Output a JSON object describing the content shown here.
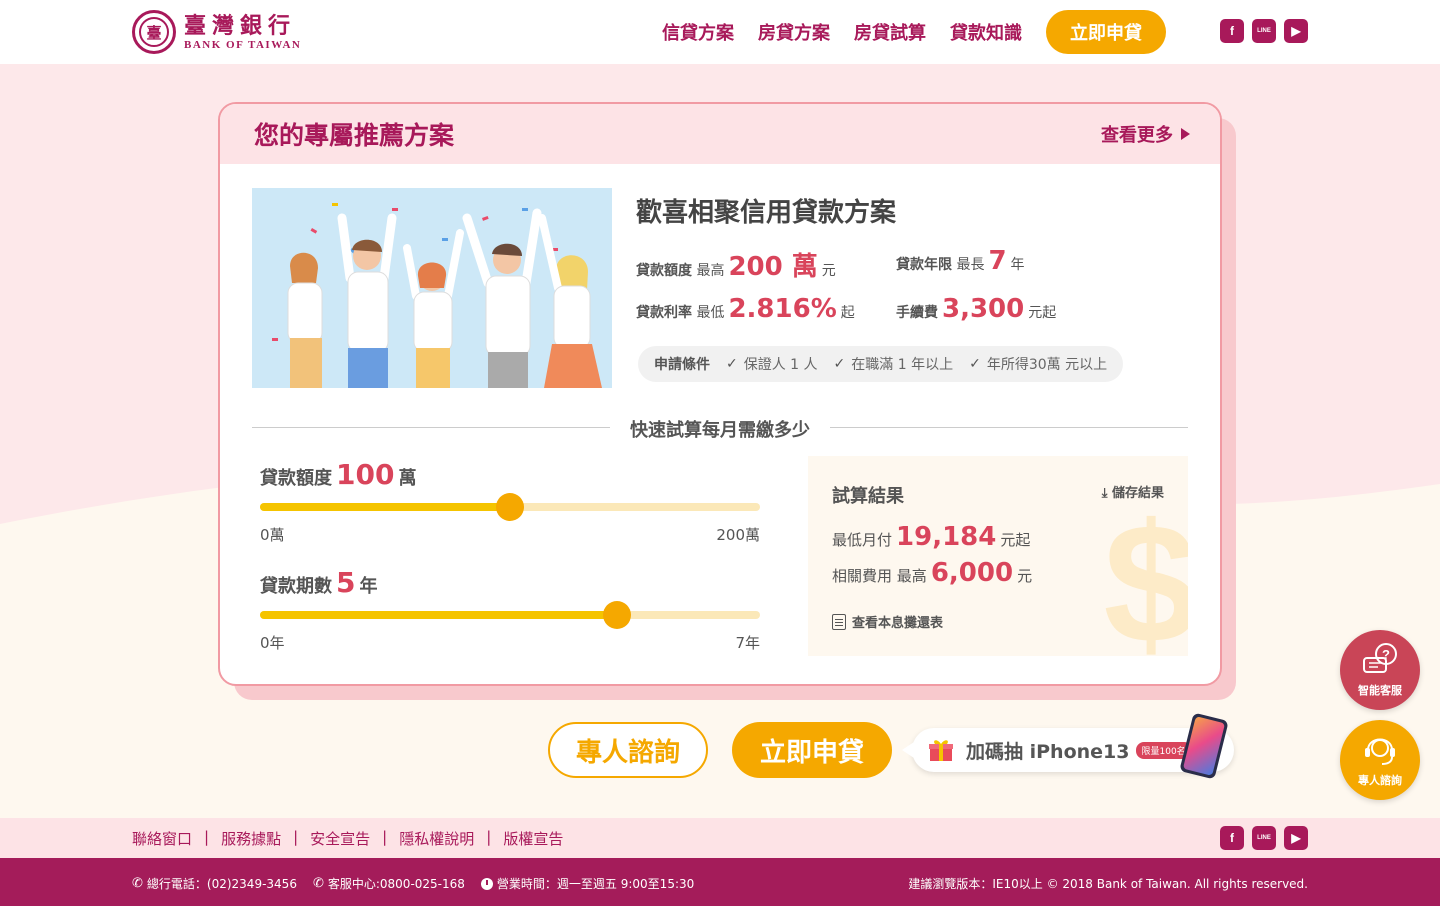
{
  "header": {
    "logo_cn": "臺灣銀行",
    "logo_en": "BANK OF TAIWAN",
    "nav": [
      "信貸方案",
      "房貸方案",
      "房貸試算",
      "貸款知識"
    ],
    "apply": "立即申貸"
  },
  "socials": {
    "facebook": "f",
    "line": "LINE",
    "youtube": "▶"
  },
  "card": {
    "title": "您的專屬推薦方案",
    "see_more": "查看更多",
    "plan_title": "歡喜相聚信用貸款方案",
    "facts": {
      "amount_label": "貸款額度",
      "amount_pre": "最高",
      "amount_val": "200 萬",
      "amount_post": "元",
      "term_label": "貸款年限",
      "term_pre": "最長",
      "term_val": "7",
      "term_post": "年",
      "rate_label": "貸款利率",
      "rate_pre": "最低",
      "rate_val": "2.816%",
      "rate_post": "起",
      "fee_label": "手續費",
      "fee_val": "3,300",
      "fee_post": "元起"
    },
    "requirements": {
      "label": "申請條件",
      "items": [
        "保證人 1 人",
        "在職滿 1 年以上",
        "年所得30萬 元以上"
      ]
    },
    "calc_heading": "快速試算每月需繳多少",
    "slider_amount": {
      "label": "貸款額度",
      "value": "100",
      "unit": "萬",
      "min": "0萬",
      "max": "200萬",
      "fraction": 0.5
    },
    "slider_term": {
      "label": "貸款期數",
      "value": "5",
      "unit": "年",
      "min": "0年",
      "max": "7年",
      "fraction": 0.714
    },
    "result": {
      "title": "試算結果",
      "save": "儲存結果",
      "monthly_label": "最低月付",
      "monthly_val": "19,184",
      "monthly_post": "元起",
      "fee_label": "相關費用",
      "fee_pre": "最高",
      "fee_val": "6,000",
      "fee_post": "元",
      "schedule": "查看本息攤還表",
      "watermark": "$"
    }
  },
  "cta": {
    "consult": "專人諮詢",
    "apply": "立即申貸",
    "promo": "加碼抽 iPhone13",
    "promo_badge": "限量100名"
  },
  "floating": {
    "ai": "智能客服",
    "person": "專人諮詢"
  },
  "footer_links": [
    "聯絡窗口",
    "服務據點",
    "安全宣告",
    "隱私權說明",
    "版權宣告"
  ],
  "footer": {
    "hq_phone": "總行電話：(02)2349-3456",
    "service": "客服中心:0800-025-168",
    "hours": "營業時間：週一至週五 9:00至15:30",
    "copyright": "建議瀏覽版本：IE10以上 © 2018 Bank of Taiwan. All rights reserved."
  },
  "colors": {
    "brand": "#a8195a",
    "accent": "#f5a800",
    "highlight": "#d9445b"
  }
}
